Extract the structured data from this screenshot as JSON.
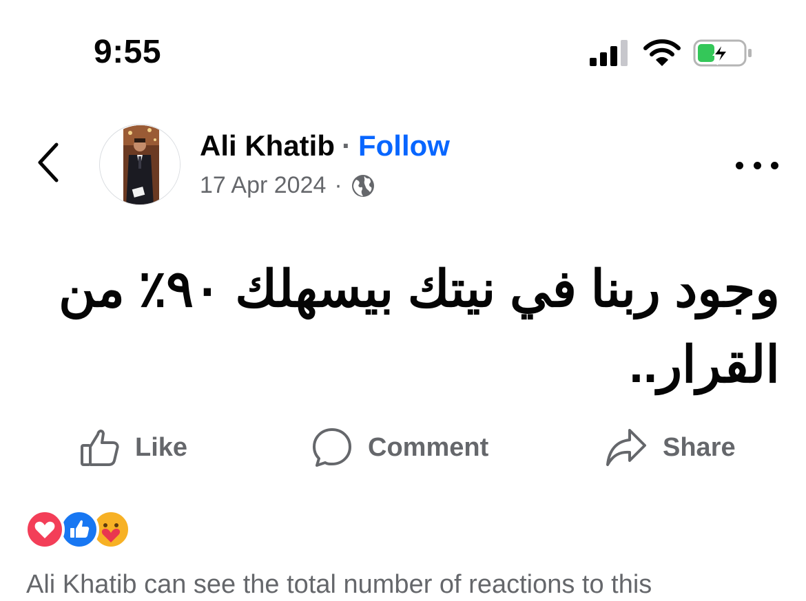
{
  "status_bar": {
    "time": "9:55",
    "icons": [
      "signal-icon",
      "wifi-icon",
      "battery-charging-icon"
    ],
    "battery_color": "#34c759"
  },
  "post": {
    "author": "Ali Khatib",
    "separator": "·",
    "follow_label": "Follow",
    "date": "17 Apr 2024",
    "meta_separator": "·",
    "audience_icon": "globe-icon",
    "text": "وجود ربنا في نيتك بيسهلك ٩٠٪ من القرار.."
  },
  "actions": [
    {
      "label": "Like",
      "icon": "like-icon"
    },
    {
      "label": "Comment",
      "icon": "comment-icon"
    },
    {
      "label": "Share",
      "icon": "share-icon"
    }
  ],
  "reactions": {
    "icons": [
      "love-reaction-icon",
      "like-reaction-icon",
      "care-reaction-icon"
    ],
    "notice": "Ali Khatib can see the total number of reactions to this"
  },
  "colors": {
    "accent": "#0866ff",
    "secondary_text": "#65676b",
    "love": "#f33e58",
    "like": "#1877f2",
    "care": "#f7b125"
  }
}
